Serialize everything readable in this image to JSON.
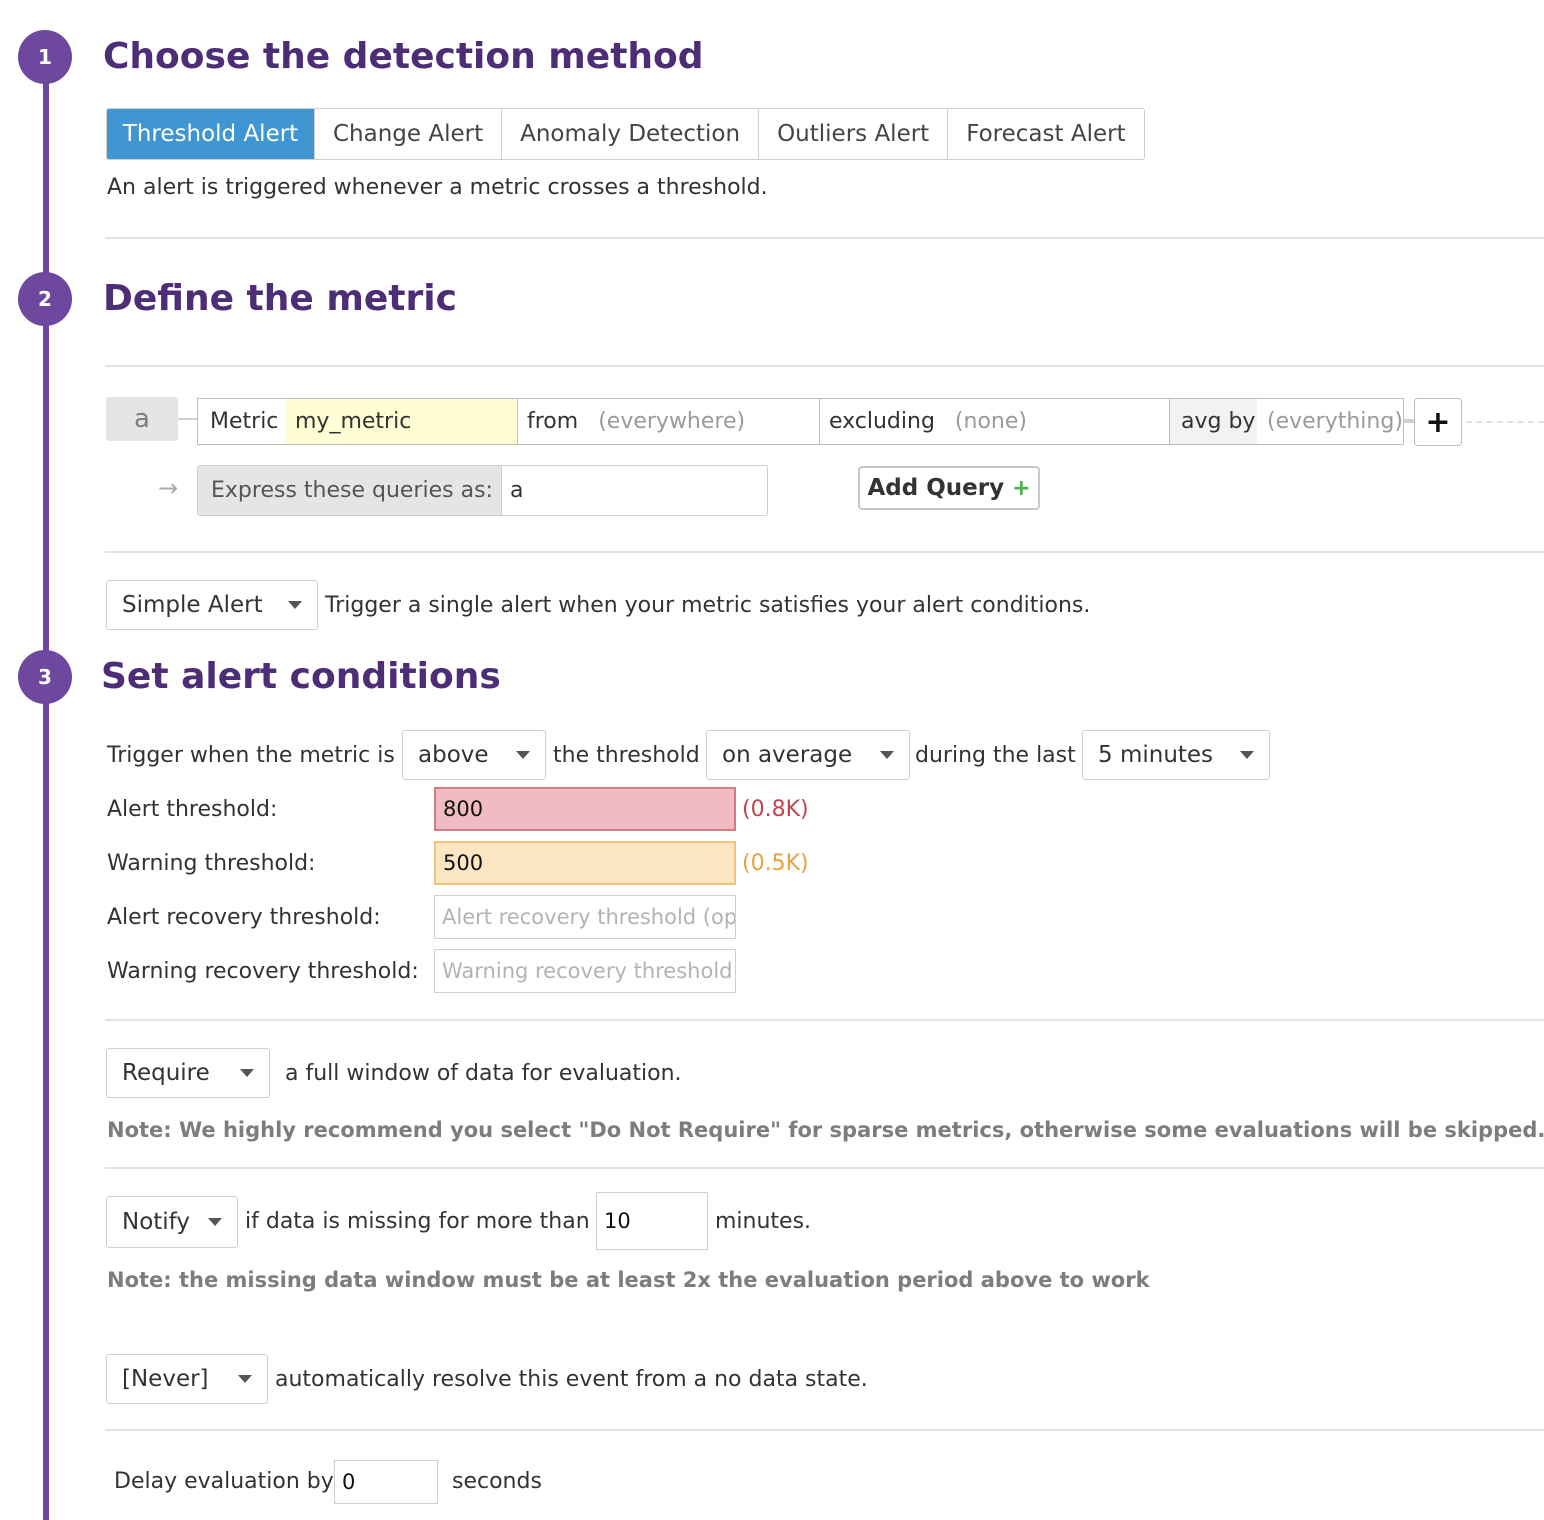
{
  "steps": [
    {
      "number": "1",
      "title": "Choose the detection method"
    },
    {
      "number": "2",
      "title": "Define the metric"
    },
    {
      "number": "3",
      "title": "Set alert conditions"
    }
  ],
  "detection": {
    "tabs": [
      {
        "label": "Threshold Alert",
        "active": true
      },
      {
        "label": "Change Alert",
        "active": false
      },
      {
        "label": "Anomaly Detection",
        "active": false
      },
      {
        "label": "Outliers Alert",
        "active": false
      },
      {
        "label": "Forecast Alert",
        "active": false
      }
    ],
    "description": "An alert is triggered whenever a metric crosses a threshold."
  },
  "metric": {
    "query_label": "a",
    "metric_label": "Metric",
    "metric_value": "my_metric",
    "from_label": "from",
    "from_value": "(everywhere)",
    "excluding_label": "excluding",
    "excluding_value": "(none)",
    "agg_label": "avg by",
    "agg_value": "(everything)",
    "add_icon": "plus-icon",
    "arrow": "→",
    "express_label": "Express these queries as:",
    "express_value": "a",
    "add_query_label": "Add Query",
    "add_query_plus": "+"
  },
  "alert_type": {
    "selected": "Simple Alert",
    "description": "Trigger a single alert when your metric satisfies your alert conditions."
  },
  "conditions": {
    "trigger_prefix": "Trigger when the metric is",
    "comparison": "above",
    "threshold_text": "the threshold",
    "aggregation": "on average",
    "during_text": "during the last",
    "window": "5 minutes",
    "alert_threshold_label": "Alert threshold:",
    "alert_threshold_value": "800",
    "alert_threshold_hint": "(0.8K)",
    "warning_threshold_label": "Warning threshold:",
    "warning_threshold_value": "500",
    "warning_threshold_hint": "(0.5K)",
    "alert_recovery_label": "Alert recovery threshold:",
    "alert_recovery_placeholder": "Alert recovery threshold (opt",
    "warning_recovery_label": "Warning recovery threshold:",
    "warning_recovery_placeholder": "Warning recovery threshold",
    "colors": {
      "alert_hint": "#c0444f",
      "warning_hint": "#e6a23c",
      "accent": "#6d489e",
      "tab_active": "#3f96d0"
    }
  },
  "full_window": {
    "selected": "Require",
    "text": "a full window of data for evaluation.",
    "note": "Note: We highly recommend you select \"Do Not Require\" for sparse metrics, otherwise some evaluations will be skipped."
  },
  "missing_data": {
    "selected": "Notify",
    "text": "if data is missing for more than",
    "minutes_value": "10",
    "unit": "minutes.",
    "note": "Note: the missing data window must be at least 2x the evaluation period above to work"
  },
  "auto_resolve": {
    "selected": "[Never]",
    "text": "automatically resolve this event from a no data state."
  },
  "delay": {
    "label": "Delay evaluation by",
    "value": "0",
    "unit": "seconds"
  }
}
